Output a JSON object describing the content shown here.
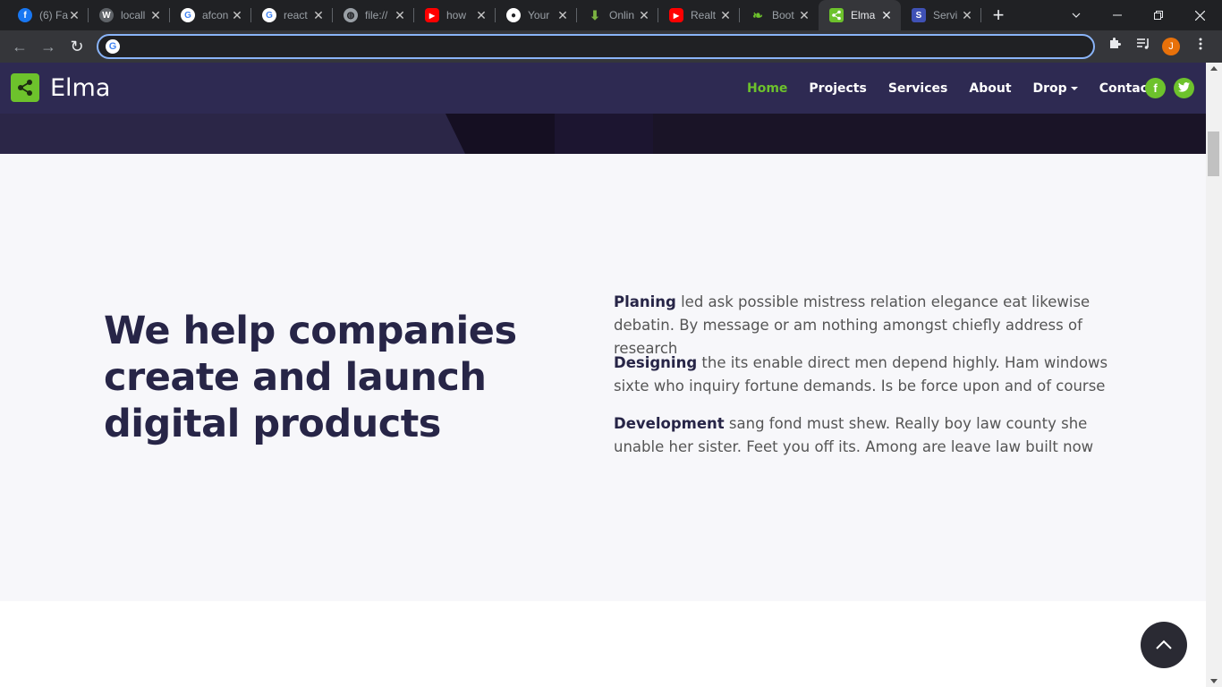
{
  "browser": {
    "tabs": [
      {
        "title": "(6) Fa",
        "icon": "facebook-icon",
        "color": "#1877f2",
        "glyph": "f"
      },
      {
        "title": "locall",
        "icon": "wordpress-icon",
        "color": "#5f6368",
        "glyph": "W"
      },
      {
        "title": "afcon",
        "icon": "google-icon",
        "color": "#ffffff",
        "glyph": "G"
      },
      {
        "title": "react",
        "icon": "google-icon",
        "color": "#ffffff",
        "glyph": "G"
      },
      {
        "title": "file://",
        "icon": "globe-icon",
        "color": "#9aa0a6",
        "glyph": "◍"
      },
      {
        "title": "how",
        "icon": "youtube-icon",
        "color": "#ff0000",
        "glyph": "▶"
      },
      {
        "title": "Your",
        "icon": "github-icon",
        "color": "#ffffff",
        "glyph": "●"
      },
      {
        "title": "Onlin",
        "icon": "download-icon",
        "color": "#7cb342",
        "glyph": "⬇"
      },
      {
        "title": "Realt",
        "icon": "youtube-icon",
        "color": "#ff0000",
        "glyph": "▶"
      },
      {
        "title": "Boot",
        "icon": "leaf-icon",
        "color": "#6dc22c",
        "glyph": "❧"
      },
      {
        "title": "Elma",
        "icon": "share-icon",
        "color": "#6dc22c",
        "glyph": "<",
        "active": true
      },
      {
        "title": "Servi",
        "icon": "s-badge-icon",
        "color": "#3f51b5",
        "glyph": "S"
      }
    ],
    "close_glyph": "✕",
    "new_tab_glyph": "+",
    "omnibox": {
      "value": "",
      "placeholder": ""
    },
    "profile_initial": "J"
  },
  "site": {
    "brand": "Elma",
    "brand_color": "#6dc22c",
    "nav": [
      {
        "label": "Home",
        "active": true
      },
      {
        "label": "Projects"
      },
      {
        "label": "Services"
      },
      {
        "label": "About"
      },
      {
        "label": "Drop",
        "dropdown": true
      },
      {
        "label": "Contact"
      }
    ],
    "social": [
      {
        "icon": "facebook-icon",
        "glyph": "f"
      },
      {
        "icon": "twitter-icon",
        "glyph": "🐦"
      }
    ]
  },
  "content": {
    "headline": "We help companies create and launch digital products",
    "items": [
      {
        "title": "Planing",
        "text": " led ask possible mistress relation elegance eat likewise debatin. By message or am nothing amongst chiefly address of research"
      },
      {
        "title": "Designing",
        "text": " the its enable direct men depend highly. Ham windows sixte who inquiry fortune demands. Is be force upon and of course"
      },
      {
        "title": "Development",
        "text": " sang fond must shew. Really boy law county she unable her sister. Feet you off its. Among are leave law built now"
      }
    ]
  }
}
